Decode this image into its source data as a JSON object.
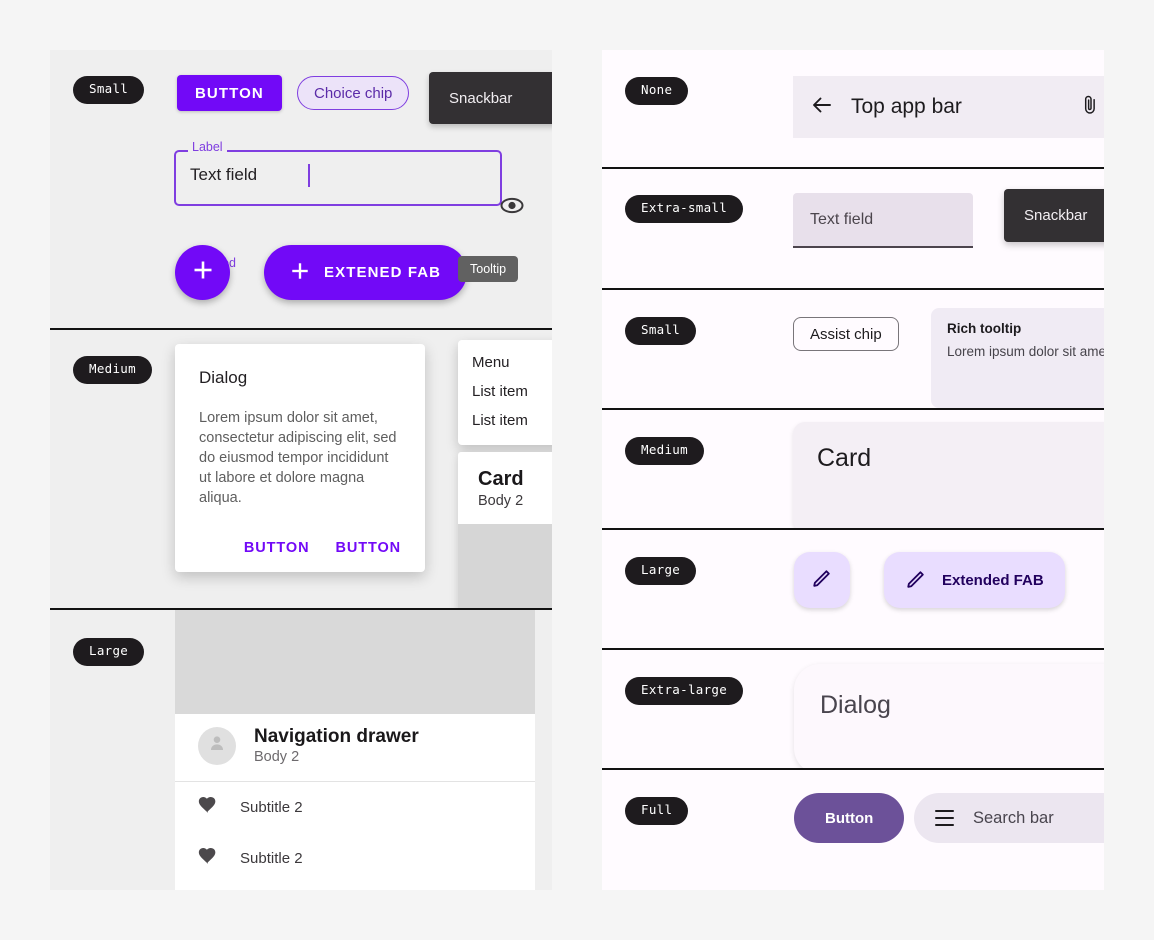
{
  "left_panel": {
    "sections": [
      {
        "label": "Small"
      },
      {
        "label": "Medium"
      },
      {
        "label": "Large"
      }
    ],
    "small": {
      "button_label": "BUTTON",
      "choice_chip_label": "Choice chip",
      "snackbar_label": "Snackbar",
      "textfield": {
        "label": "Label",
        "value": "Text field",
        "helper": "Focused",
        "trailing_icon": "eye-icon"
      },
      "fab_icon": "plus-icon",
      "extended_fab_label": "EXTENED FAB",
      "extended_fab_icon": "plus-icon",
      "tooltip_label": "Tooltip"
    },
    "medium": {
      "dialog": {
        "title": "Dialog",
        "body": "Lorem ipsum dolor sit amet, consectetur adipiscing elit, sed do eiusmod tempor incididunt ut labore et dolore magna aliqua.",
        "button_1": "BUTTON",
        "button_2": "BUTTON"
      },
      "menu": {
        "header": "Menu",
        "items": [
          "List item",
          "List item"
        ]
      },
      "card": {
        "title": "Card",
        "subtitle": "Body 2"
      }
    },
    "large": {
      "drawer": {
        "title": "Navigation drawer",
        "subtitle": "Body 2",
        "avatar_icon": "person-icon",
        "items": [
          {
            "icon": "heart-icon",
            "label": "Subtitle 2"
          },
          {
            "icon": "heart-icon",
            "label": "Subtitle 2"
          }
        ]
      }
    }
  },
  "right_panel": {
    "sections": [
      {
        "label": "None"
      },
      {
        "label": "Extra-small"
      },
      {
        "label": "Small"
      },
      {
        "label": "Medium"
      },
      {
        "label": "Large"
      },
      {
        "label": "Extra-large"
      },
      {
        "label": "Full"
      }
    ],
    "none": {
      "top_app_bar": {
        "back_icon": "arrow-left-icon",
        "title": "Top app bar",
        "action_icon": "paperclip-icon"
      }
    },
    "extra_small": {
      "textfield_placeholder": "Text field",
      "snackbar_label": "Snackbar"
    },
    "small": {
      "assist_chip_label": "Assist chip",
      "rich_tooltip": {
        "title": "Rich tooltip",
        "body": "Lorem ipsum dolor sit amet, consectetur adipiscing elit. Nullam et urna congue consectetur. Vivamus"
      }
    },
    "medium": {
      "card_title": "Card"
    },
    "large": {
      "fab_icon": "pencil-icon",
      "extended_fab_label": "Extended FAB",
      "extended_fab_icon": "pencil-icon"
    },
    "extra_large": {
      "dialog_title": "Dialog"
    },
    "full": {
      "button_label": "Button",
      "search_bar_placeholder": "Search bar",
      "search_bar_leading_icon": "hamburger-icon"
    }
  },
  "colors": {
    "accent_purple": "#7209f7",
    "pill_dark": "#1e1b1e",
    "snackbar_dark": "#333033",
    "fab_container": "#e9ddff",
    "fab_on_container": "#21005e",
    "left_panel_bg": "#efefef",
    "right_panel_bg": "#fffbff",
    "page_bg": "#f5f5f5"
  }
}
